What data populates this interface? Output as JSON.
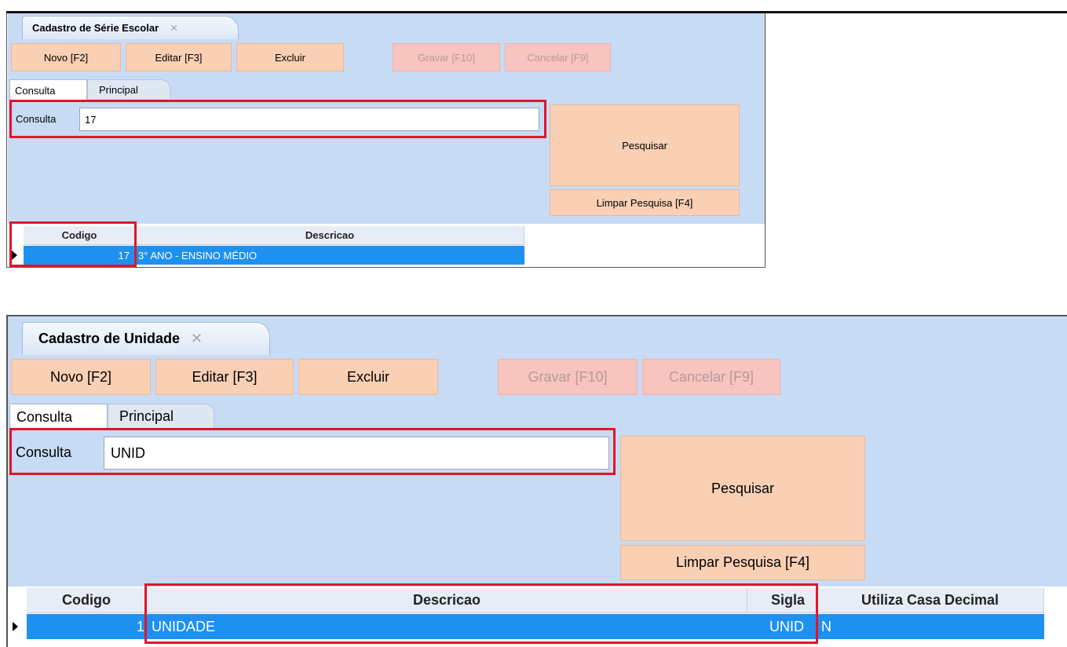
{
  "top": {
    "window_title": "Cadastro de Série Escolar",
    "toolbar": {
      "novo": "Novo [F2]",
      "editar": "Editar [F3]",
      "excluir": "Excluir",
      "gravar": "Gravar [F10]",
      "cancelar": "Cancelar [F9]"
    },
    "tabs": {
      "consulta": "Consulta",
      "principal": "Principal"
    },
    "consulta_label": "Consulta",
    "consulta_value": "17",
    "pesquisar": "Pesquisar",
    "limpar": "Limpar Pesquisa [F4]",
    "grid": {
      "headers": [
        "Codigo",
        "Descricao"
      ],
      "rows": [
        {
          "codigo": "17",
          "descricao": "3° ANO - ENSINO MÉDIO"
        }
      ]
    }
  },
  "bottom": {
    "window_title": "Cadastro de Unidade",
    "toolbar": {
      "novo": "Novo [F2]",
      "editar": "Editar [F3]",
      "excluir": "Excluir",
      "gravar": "Gravar [F10]",
      "cancelar": "Cancelar [F9]"
    },
    "tabs": {
      "consulta": "Consulta",
      "principal": "Principal"
    },
    "consulta_label": "Consulta",
    "consulta_value": "UNID",
    "pesquisar": "Pesquisar",
    "limpar": "Limpar Pesquisa [F4]",
    "grid": {
      "headers": [
        "Codigo",
        "Descricao",
        "Sigla",
        "Utiliza Casa Decimal"
      ],
      "rows": [
        {
          "codigo": "1",
          "descricao": "UNIDADE",
          "sigla": "UNID",
          "utiliza": "N"
        }
      ]
    }
  },
  "colors": {
    "panel": "#c7dbf5",
    "button": "#fad0b5",
    "button_disabled": "#f8c4c0",
    "selection": "#1e90f0",
    "highlight_box": "#e3152a"
  },
  "icons": {
    "close": "close-icon",
    "row_indicator": "row-pointer-icon"
  }
}
